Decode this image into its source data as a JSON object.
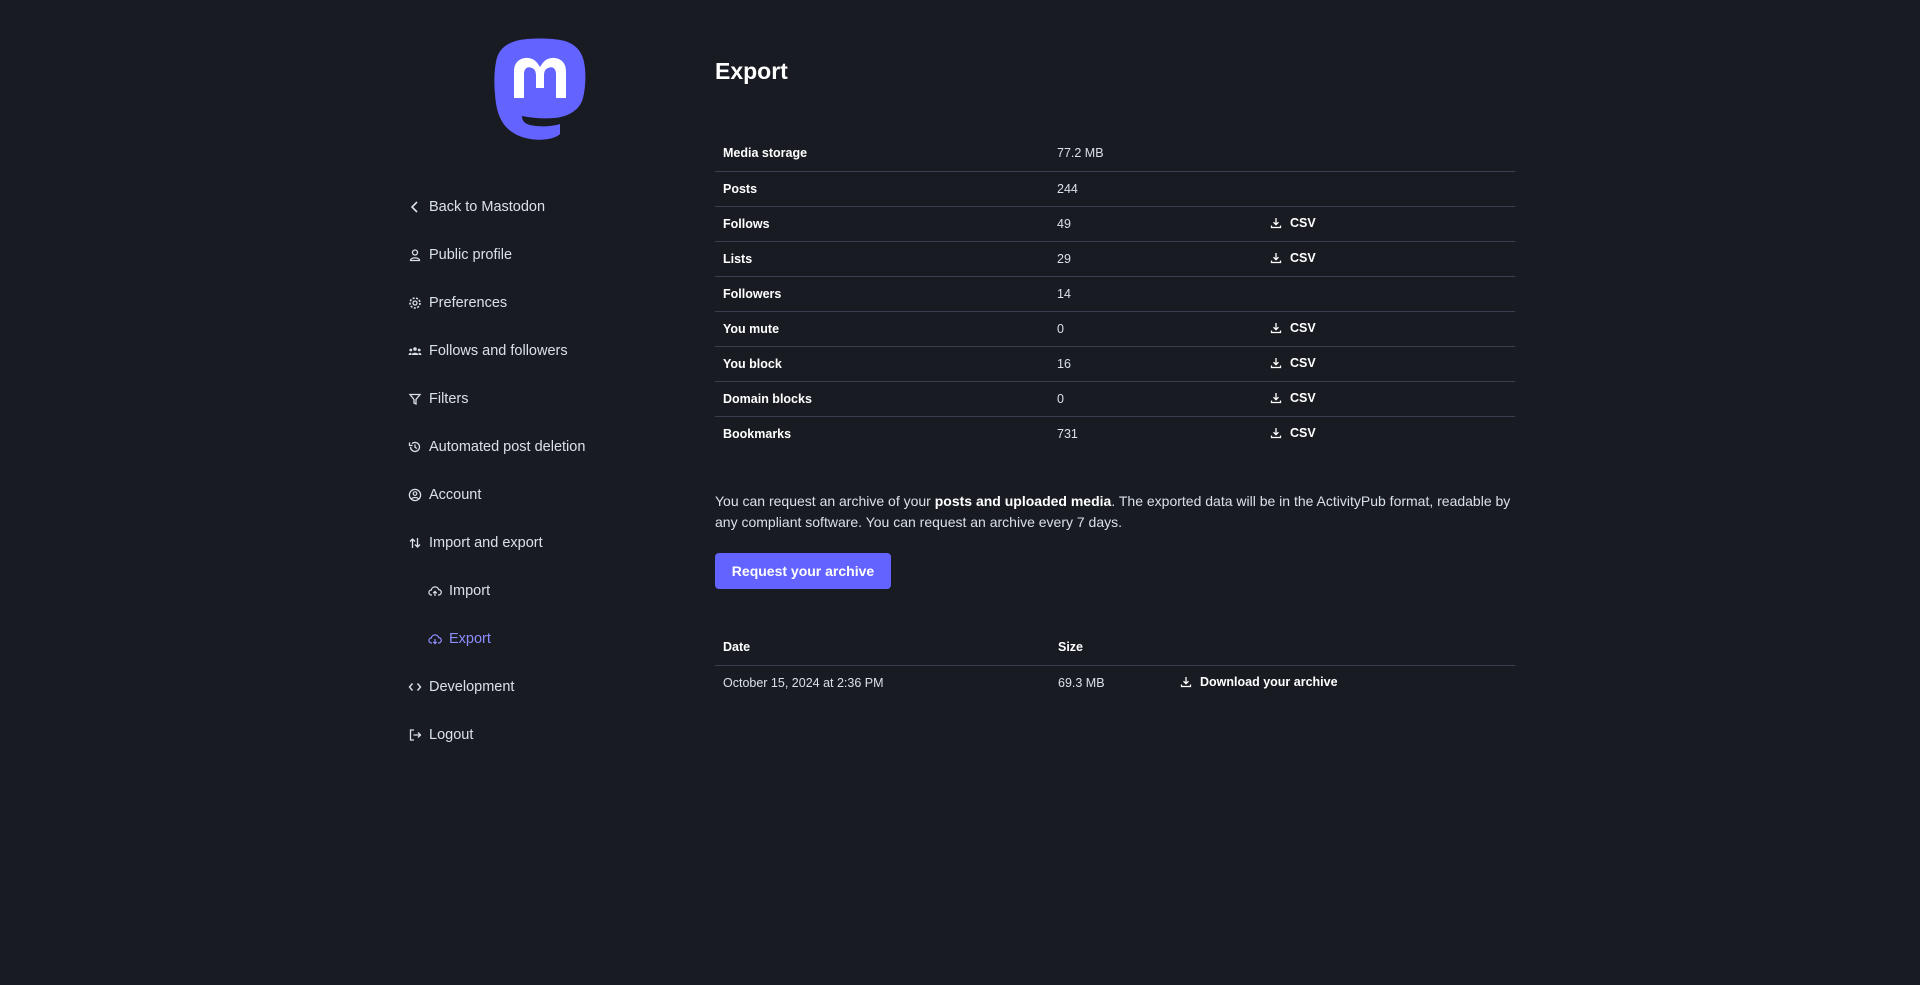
{
  "brand": {
    "accent_color": "#6364ff",
    "logo_icon": "mastodon-logo-icon"
  },
  "sidebar": {
    "items": [
      {
        "label": "Back to Mastodon",
        "icon": "chevron-left-icon"
      },
      {
        "label": "Public profile",
        "icon": "person-icon"
      },
      {
        "label": "Preferences",
        "icon": "gear-icon"
      },
      {
        "label": "Follows and followers",
        "icon": "group-icon"
      },
      {
        "label": "Filters",
        "icon": "filter-icon"
      },
      {
        "label": "Automated post deletion",
        "icon": "history-icon"
      },
      {
        "label": "Account",
        "icon": "account-circle-icon"
      },
      {
        "label": "Import and export",
        "icon": "import-export-icon"
      },
      {
        "label": "Import",
        "icon": "cloud-upload-icon"
      },
      {
        "label": "Export",
        "icon": "cloud-download-icon",
        "active": true
      },
      {
        "label": "Development",
        "icon": "code-icon"
      },
      {
        "label": "Logout",
        "icon": "logout-icon"
      }
    ]
  },
  "main": {
    "title": "Export",
    "stats": [
      {
        "label": "Media storage",
        "value": "77.2 MB",
        "download": ""
      },
      {
        "label": "Posts",
        "value": "244",
        "download": ""
      },
      {
        "label": "Follows",
        "value": "49",
        "download": "CSV"
      },
      {
        "label": "Lists",
        "value": "29",
        "download": "CSV"
      },
      {
        "label": "Followers",
        "value": "14",
        "download": ""
      },
      {
        "label": "You mute",
        "value": "0",
        "download": "CSV"
      },
      {
        "label": "You block",
        "value": "16",
        "download": "CSV"
      },
      {
        "label": "Domain blocks",
        "value": "0",
        "download": "CSV"
      },
      {
        "label": "Bookmarks",
        "value": "731",
        "download": "CSV"
      }
    ],
    "archive_text": {
      "before": "You can request an archive of your ",
      "bold": "posts and uploaded media",
      "after": ". The exported data will be in the ActivityPub format, readable by any compliant software. You can request an archive every 7 days."
    },
    "request_button": "Request your archive",
    "archives_table": {
      "headers": {
        "date": "Date",
        "size": "Size"
      },
      "rows": [
        {
          "date": "October 15, 2024 at 2:36 PM",
          "size": "69.3 MB",
          "download": "Download your archive"
        }
      ]
    }
  }
}
